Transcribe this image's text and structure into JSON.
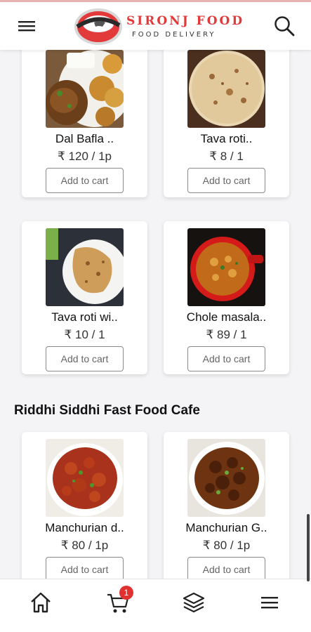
{
  "brand": {
    "name": "SIRONJ FOOD",
    "tagline": "FOOD DELIVERY"
  },
  "icons": {
    "menu": "hamburger-menu-icon",
    "search": "search-icon",
    "home": "home-icon",
    "cart": "cart-icon",
    "layers": "layers-icon",
    "more": "more-menu-icon"
  },
  "colors": {
    "accent": "#e23a3a",
    "badge": "#e03030"
  },
  "items": [
    {
      "name": "Dal Bafla ..",
      "price": "₹ 120 / 1p",
      "button": "Add to cart"
    },
    {
      "name": "Tava roti..",
      "price": "₹ 8 / 1",
      "button": "Add to cart"
    },
    {
      "name": "Tava roti wi..",
      "price": "₹ 10 / 1",
      "button": "Add to cart"
    },
    {
      "name": "Chole masala..",
      "price": "₹ 89 / 1",
      "button": "Add to cart"
    }
  ],
  "section": {
    "title": "Riddhi Siddhi Fast Food Cafe",
    "items": [
      {
        "name": "Manchurian d..",
        "price": "₹ 80 / 1p",
        "button": "Add to cart"
      },
      {
        "name": "Manchurian G..",
        "price": "₹ 80 / 1p",
        "button": "Add to cart"
      }
    ]
  },
  "cart": {
    "badge_count": "1"
  }
}
